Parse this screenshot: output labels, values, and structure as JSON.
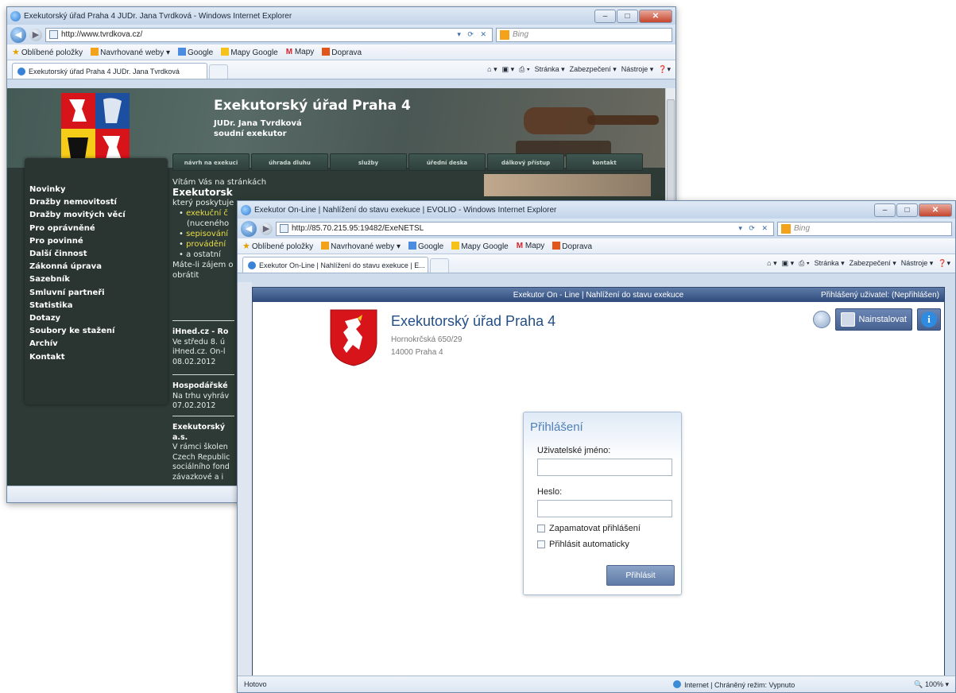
{
  "window1": {
    "title": "Exekutorský úřad Praha 4 JUDr. Jana Tvrdková - Windows Internet Explorer",
    "url": "http://www.tvrdkova.cz/",
    "search_placeholder": "Bing",
    "tab_title": "Exekutorský úřad Praha 4 JUDr. Jana Tvrdková",
    "favorites": [
      "Oblíbené položky",
      "Navrhované weby ▾",
      "Google",
      "Mapy Google",
      "Mapy",
      "Doprava"
    ],
    "commands": [
      "Stránka ▾",
      "Zabezpečení ▾",
      "Nástroje ▾"
    ],
    "site": {
      "title": "Exekutorský úřad Praha 4",
      "subtitle_1": "JUDr. Jana Tvrdková",
      "subtitle_2": "soudní exekutor",
      "topnav": [
        "návrh na exekuci",
        "úhrada dluhu",
        "služby",
        "úřední deska",
        "dálkový přístup",
        "kontakt"
      ],
      "leftnav": [
        "Novinky",
        "Dražby nemovitostí",
        "Dražby movitých věcí",
        "Pro oprávněné",
        "Pro povinné",
        "Další činnost",
        "Zákonná úprava",
        "Sazebník",
        "Smluvní partneři",
        "Statistika",
        "Dotazy",
        "Soubory ke stažení",
        "Archív",
        "Kontakt"
      ],
      "welcome": "Vítám Vás na stránkách",
      "heading": "Exekutorsk",
      "intro": "který poskytuje",
      "bullets": [
        "exekuční č",
        "(nuceného",
        "sepisování",
        "provádění",
        "a ostatní"
      ],
      "more_1": "Máte-li zájem o",
      "more_2": "obrátit",
      "news": [
        {
          "title": "iHned.cz - Ro",
          "lines": [
            "Ve středu 8. ú",
            "iHned.cz. On-l",
            "08.02.2012"
          ]
        },
        {
          "title": "Hospodářské",
          "lines": [
            "Na trhu vyhráv",
            "07.02.2012"
          ]
        },
        {
          "title": "Exekutorský",
          "title2": "a.s.",
          "lines": [
            "V rámci školen",
            "Czech Republic",
            "sociálního fond",
            "závazkové a i"
          ]
        }
      ]
    },
    "status": ""
  },
  "window2": {
    "title": "Exekutor On-Line | Nahlížení do stavu exekuce | EVOLIO - Windows Internet Explorer",
    "url": "http://85.70.215.95:19482/ExeNETSL",
    "search_placeholder": "Bing",
    "tab_title": "Exekutor On-Line | Nahlížení do stavu exekuce | E...",
    "favorites": [
      "Oblíbené položky",
      "Navrhované weby ▾",
      "Google",
      "Mapy Google",
      "Mapy",
      "Doprava"
    ],
    "commands": [
      "Stránka ▾",
      "Zabezpečení ▾",
      "Nástroje ▾"
    ],
    "app": {
      "header_center": "Exekutor On - Line | Nahlížení do stavu exekuce",
      "header_right": "Přihlášený uživatel:  (Nepřihlášen)",
      "org_name": "Exekutorský úřad Praha 4",
      "org_street": "Hornokrčská 650/29",
      "org_city": "14000   Praha 4",
      "install_label": "Nainstalovat",
      "login": {
        "title": "Přihlášení",
        "username_label": "Uživatelské jméno:",
        "username_value": "",
        "password_label": "Heslo:",
        "password_value": "",
        "remember_label": "Zapamatovat přihlášení",
        "auto_label": "Přihlásit automaticky",
        "submit_label": "Přihlásit"
      }
    },
    "status": {
      "left": "Hotovo",
      "zone": "Internet | Chráněný režim: Vypnuto",
      "zoom": "100%"
    }
  }
}
